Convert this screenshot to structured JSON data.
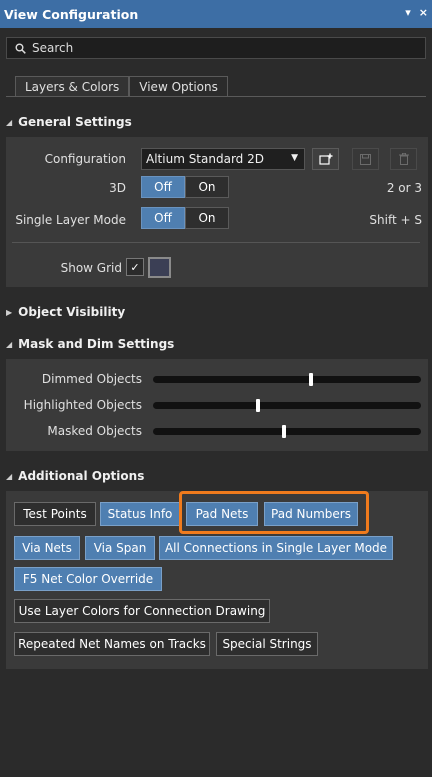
{
  "window": {
    "title": "View Configuration",
    "controls": [
      "▾",
      "×"
    ]
  },
  "search": {
    "placeholder": "Search"
  },
  "tabs": [
    {
      "label": "Layers & Colors"
    },
    {
      "label": "View Options",
      "active": true
    }
  ],
  "general": {
    "title": "General Settings",
    "configuration_label": "Configuration",
    "configuration_value": "Altium Standard 2D",
    "three_d_label": "3D",
    "three_d_state": "Off",
    "three_d_shortcut": "2 or 3",
    "single_layer_label": "Single Layer Mode",
    "single_layer_state": "Off",
    "single_layer_shortcut": "Shift + S",
    "off_label": "Off",
    "on_label": "On",
    "show_grid_label": "Show Grid",
    "show_grid_checked": true
  },
  "object_visibility": {
    "title": "Object Visibility"
  },
  "mask_dim": {
    "title": "Mask and Dim Settings",
    "sliders": [
      {
        "label": "Dimmed Objects",
        "value_pct": 59
      },
      {
        "label": "Highlighted Objects",
        "value_pct": 39
      },
      {
        "label": "Masked Objects",
        "value_pct": 49
      }
    ]
  },
  "additional": {
    "title": "Additional Options",
    "buttons": [
      {
        "label": "Test Points",
        "on": false
      },
      {
        "label": "Status Info",
        "on": true
      },
      {
        "label": "Pad Nets",
        "on": true
      },
      {
        "label": "Pad Numbers",
        "on": true
      },
      {
        "label": "Via Nets",
        "on": true
      },
      {
        "label": "Via Span",
        "on": true
      },
      {
        "label": "All Connections in Single Layer Mode",
        "on": true
      },
      {
        "label": "F5  Net Color Override",
        "on": true
      },
      {
        "label": "Use Layer Colors for Connection Drawing",
        "on": false
      },
      {
        "label": "Repeated Net Names on Tracks",
        "on": false
      },
      {
        "label": "Special Strings",
        "on": false
      }
    ]
  },
  "colors": {
    "title_bar": "#3d6ea5",
    "toggle_on": "#4f7fb1",
    "highlight": "#f07b1d"
  }
}
